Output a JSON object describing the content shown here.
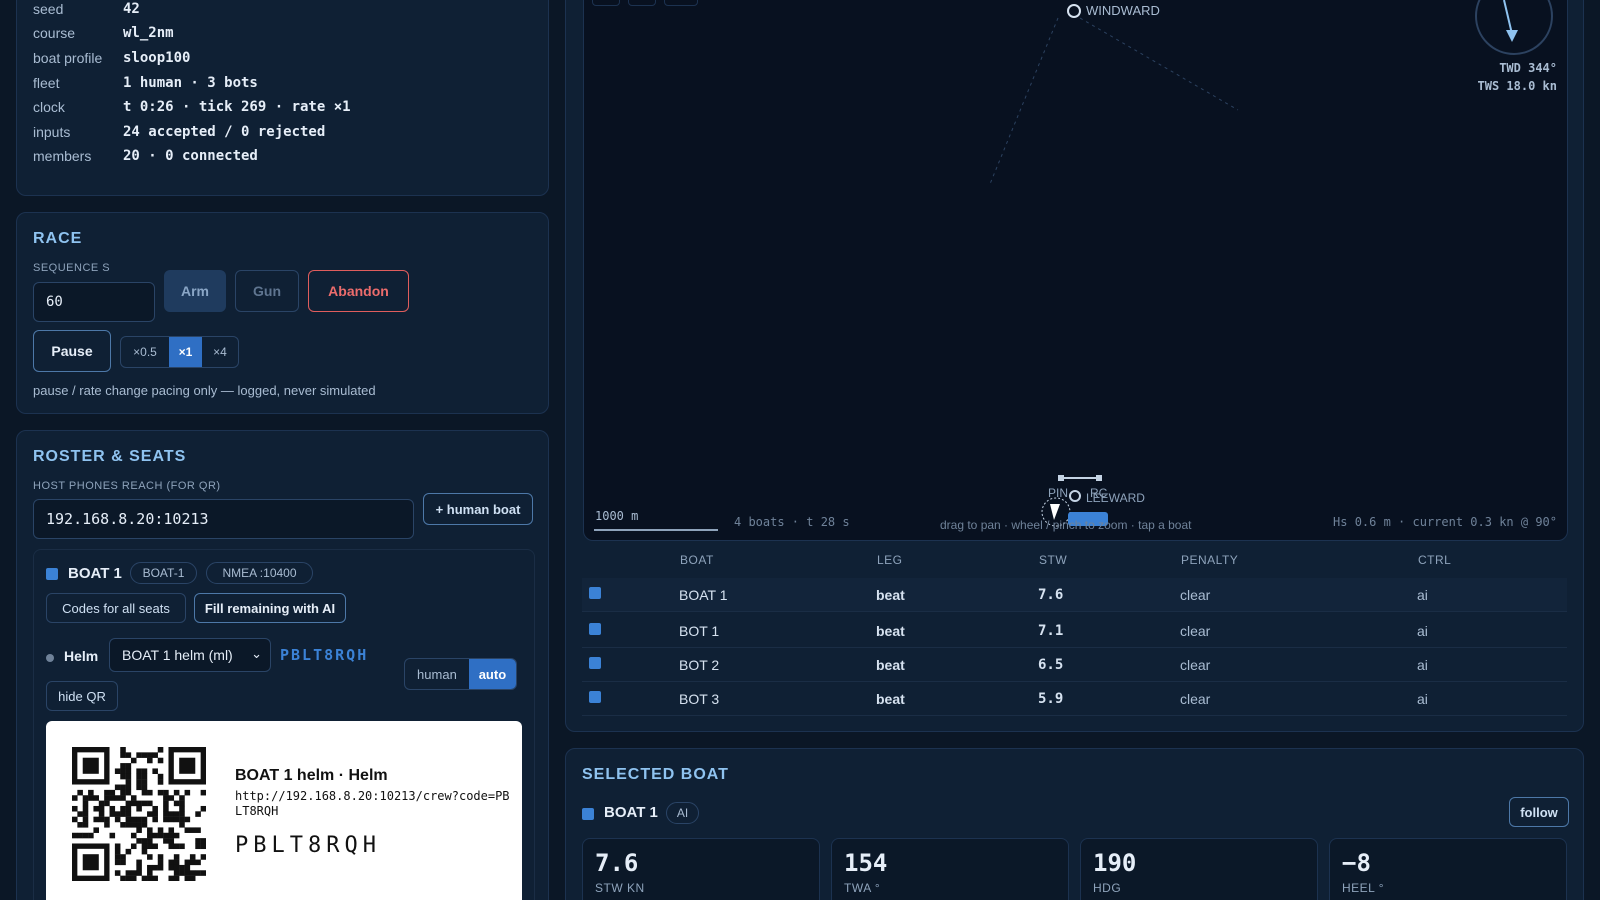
{
  "session": {
    "rows": [
      {
        "k": "seed",
        "v": "42"
      },
      {
        "k": "course",
        "v": "wl_2nm"
      },
      {
        "k": "boat profile",
        "v": "sloop100"
      },
      {
        "k": "fleet",
        "v": "1 human · 3 bots"
      },
      {
        "k": "clock",
        "v": "t 0:26 · tick 269 · rate ×1"
      },
      {
        "k": "inputs",
        "v": "24 accepted / 0 rejected"
      },
      {
        "k": "members",
        "v": "20 · 0 connected"
      }
    ]
  },
  "race": {
    "title": "RACE",
    "sequence_label": "SEQUENCE S",
    "sequence_value": "60",
    "arm": "Arm",
    "gun": "Gun",
    "abandon": "Abandon",
    "pause": "Pause",
    "rates": [
      "×0.5",
      "×1",
      "×4"
    ],
    "note": "pause / rate change pacing only — logged, never simulated"
  },
  "roster": {
    "title": "ROSTER & SEATS",
    "host_label": "HOST PHONES REACH (FOR QR)",
    "host_value": "192.168.8.20:10213",
    "add_human": "+ human boat",
    "boat_name": "BOAT 1",
    "boat_tag": "BOAT-1",
    "nmea": "NMEA :10400",
    "codes_btn": "Codes for all seats",
    "fill_btn": "Fill remaining with AI",
    "helm_label": "Helm",
    "helm_select": "BOAT 1 helm (ml)",
    "helm_code": "PBLT8RQH",
    "mode_human": "human",
    "mode_auto": "auto",
    "hide_qr": "hide QR",
    "qr_title": "BOAT 1 helm · Helm",
    "qr_url": "http://192.168.8.20:10213/crew?code=PBLT8RQH",
    "qr_code": "PBLT8RQH"
  },
  "map": {
    "windward": "WINDWARD",
    "twd": "TWD 344°",
    "tws": "TWS 18.0 kn",
    "pin": "PIN",
    "rc": "RC",
    "leeward": "LEEWARD",
    "scale": "1000 m",
    "status": "4 boats · t 28 s",
    "hint": "drag to pan · wheel / pinch to zoom · tap a boat",
    "conditions": "Hs 0.6 m · current 0.3 kn @ 90°"
  },
  "table": {
    "headers": [
      "BOAT",
      "LEG",
      "STW",
      "PENALTY",
      "CTRL"
    ],
    "rows": [
      {
        "boat": "BOAT 1",
        "leg": "beat",
        "stw": "7.6",
        "penalty": "clear",
        "ctrl": "ai"
      },
      {
        "boat": "BOT 1",
        "leg": "beat",
        "stw": "7.1",
        "penalty": "clear",
        "ctrl": "ai"
      },
      {
        "boat": "BOT 2",
        "leg": "beat",
        "stw": "6.5",
        "penalty": "clear",
        "ctrl": "ai"
      },
      {
        "boat": "BOT 3",
        "leg": "beat",
        "stw": "5.9",
        "penalty": "clear",
        "ctrl": "ai"
      }
    ]
  },
  "selected": {
    "title": "SELECTED BOAT",
    "boat": "BOAT 1",
    "badge": "AI",
    "follow": "follow",
    "metrics": [
      {
        "val": "7.6",
        "unit": "STW KN"
      },
      {
        "val": "154",
        "unit": "TWA °"
      },
      {
        "val": "190",
        "unit": "HDG"
      },
      {
        "val": "−8",
        "unit": "HEEL °"
      }
    ]
  },
  "colors": {
    "accent": "#3b82d6",
    "danger": "#e05d5d",
    "bg": "#0b1726"
  }
}
